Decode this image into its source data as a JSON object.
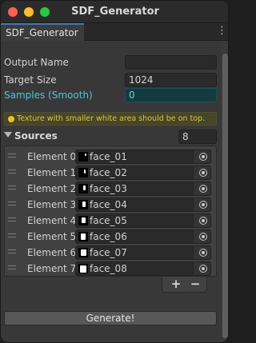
{
  "window": {
    "title": "SDF_Generator"
  },
  "tab": {
    "label": "SDF_Generator",
    "menu_icon": "⋮"
  },
  "fields": {
    "output_name": {
      "label": "Output Name",
      "value": ""
    },
    "target_size": {
      "label": "Target Size",
      "value": "1024"
    },
    "samples": {
      "label": "Samples (Smooth)",
      "value": "0"
    }
  },
  "warning": {
    "text": "Texture with smaller white area should be on top."
  },
  "sources": {
    "label": "Sources",
    "count": "8",
    "items": [
      {
        "label": "Element 0",
        "value": "face_01"
      },
      {
        "label": "Element 1",
        "value": "face_02"
      },
      {
        "label": "Element 2",
        "value": "face_03"
      },
      {
        "label": "Element 3",
        "value": "face_04"
      },
      {
        "label": "Element 4",
        "value": "face_05"
      },
      {
        "label": "Element 5",
        "value": "face_06"
      },
      {
        "label": "Element 6",
        "value": "face_07"
      },
      {
        "label": "Element 7",
        "value": "face_08"
      }
    ]
  },
  "list_controls": {
    "add": "+",
    "remove": "−"
  },
  "generate": {
    "label": "Generate!"
  },
  "colors": {
    "accent_tab": "#3a79bb",
    "teal": "#4ec7d9",
    "warning": "#d8c743"
  }
}
